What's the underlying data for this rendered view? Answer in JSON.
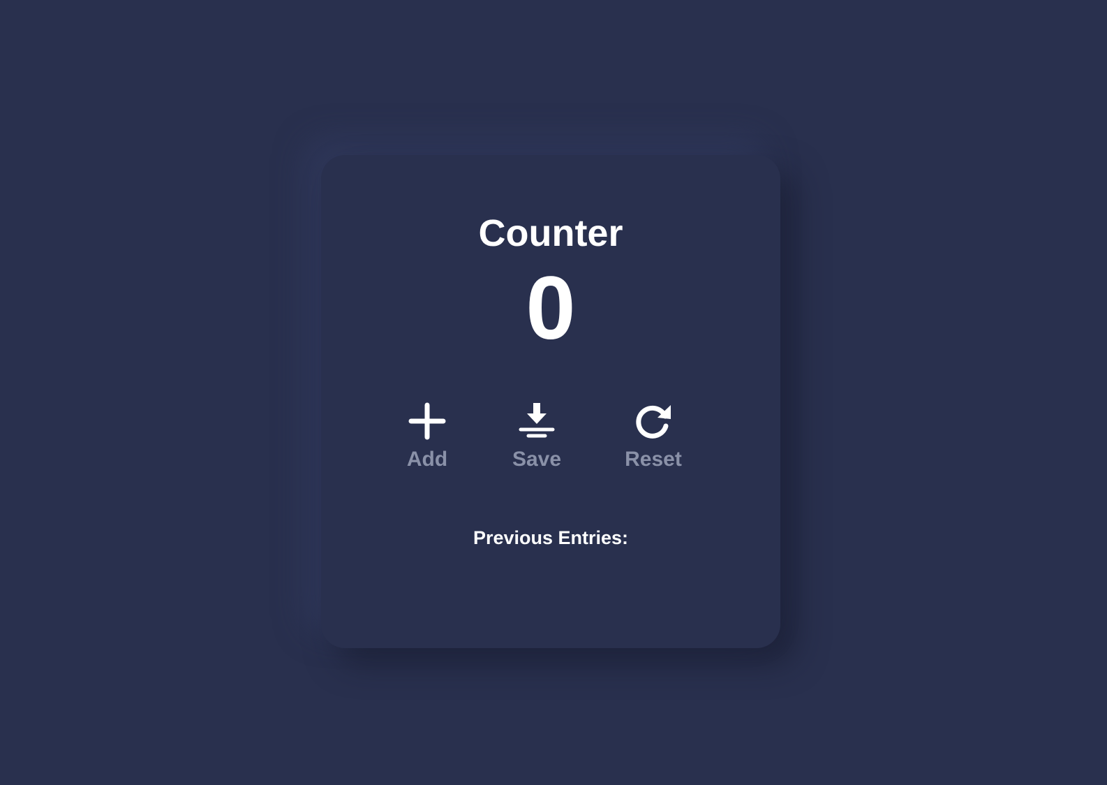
{
  "counter": {
    "title": "Counter",
    "value": "0"
  },
  "actions": {
    "add": {
      "label": "Add",
      "icon": "plus-icon"
    },
    "save": {
      "label": "Save",
      "icon": "download-icon"
    },
    "reset": {
      "label": "Reset",
      "icon": "rotate-icon"
    }
  },
  "entries": {
    "heading": "Previous Entries:",
    "items": []
  },
  "colors": {
    "background": "#29304e",
    "text": "#ffffff",
    "muted_label": "#8a91a8"
  }
}
